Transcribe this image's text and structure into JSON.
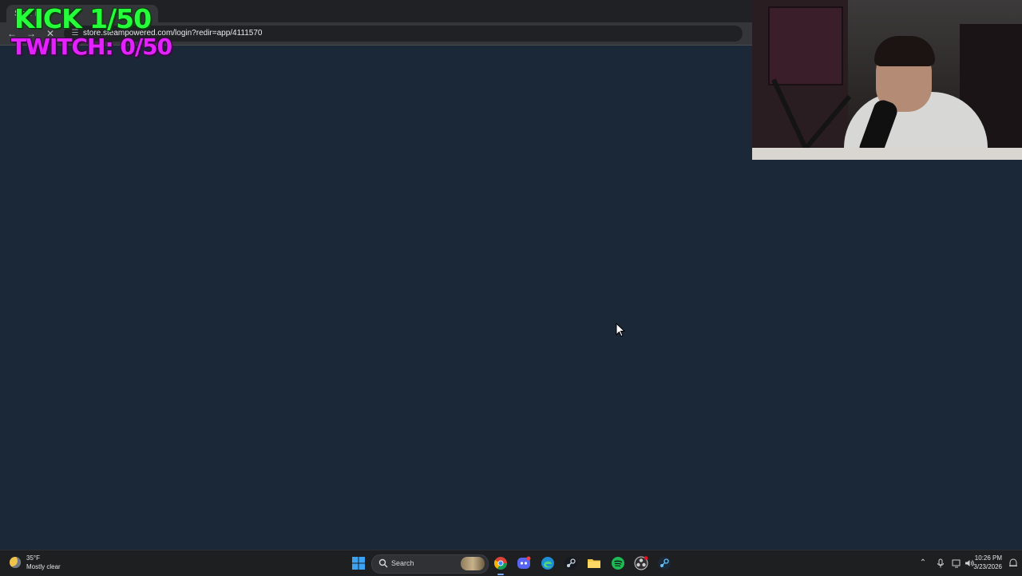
{
  "browser": {
    "tab_title": "Sign In",
    "url": "store.steampowered.com/login?redir=app/4111570"
  },
  "overlay": {
    "kick_counter": "KICK 1/50",
    "twitch_counter": "TWITCH: 0/50",
    "kick_color": "#25ff3a",
    "twitch_color": "#e322ff"
  },
  "page": {
    "background": "#1b2838"
  },
  "taskbar": {
    "weather": {
      "temperature": "35°F",
      "condition": "Mostly clear"
    },
    "search_label": "Search",
    "pinned_apps": [
      "windows-start",
      "chrome",
      "discord",
      "edge",
      "steam",
      "file-explorer",
      "spotify",
      "obs",
      "steam-alt"
    ],
    "clock": {
      "time": "10:26 PM",
      "date": "3/23/2026"
    }
  }
}
